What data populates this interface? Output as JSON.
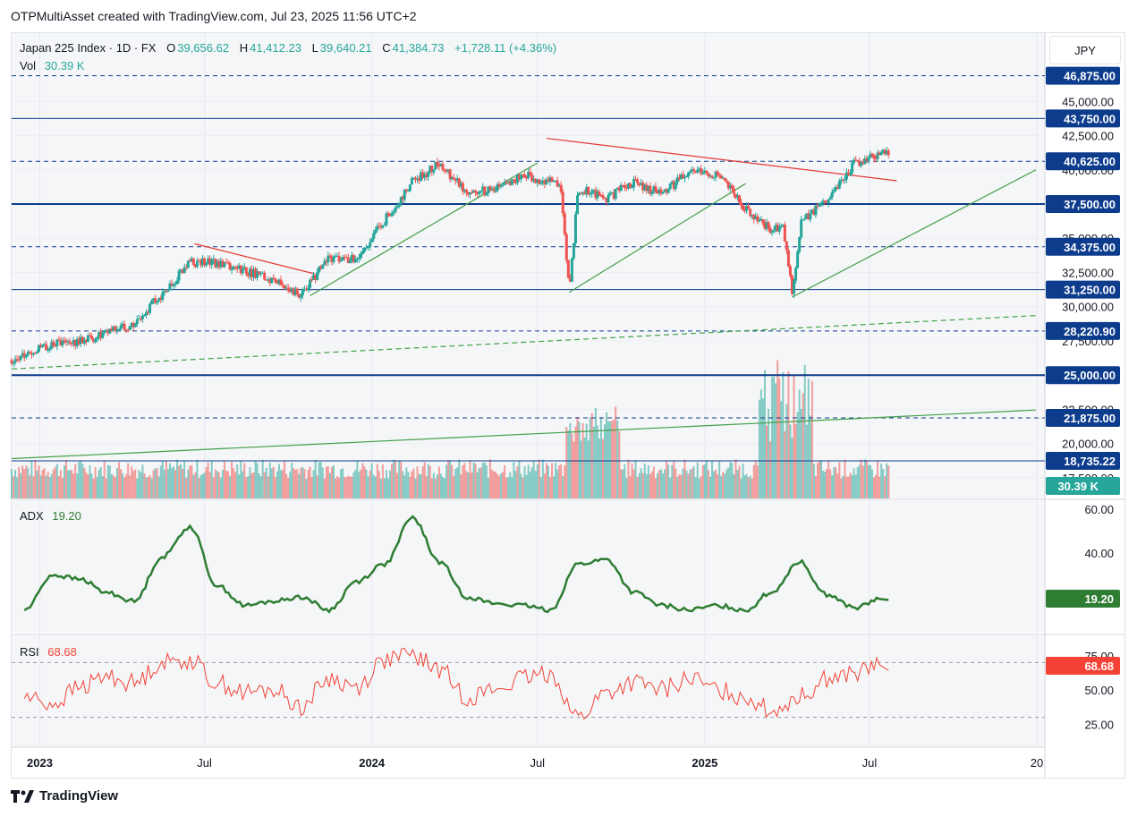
{
  "header": {
    "text": "OTPMultiAsset created with TradingView.com, Jul 23, 2025 11:56 UTC+2"
  },
  "footer": {
    "brand": "TradingView",
    "logo_icon": "tradingview-logo-icon"
  },
  "price_pane": {
    "currency": "JPY",
    "symbol_line": "Japan 225 Index · 1D · FX",
    "ohlc": {
      "o_label": "O",
      "o": "39,656.62",
      "h_label": "H",
      "h": "41,412.23",
      "l_label": "L",
      "l": "39,640.21",
      "c_label": "C",
      "c": "41,384.73",
      "change": "+1,728.11 (+4.36%)"
    },
    "vol_label": "Vol",
    "vol_value": "30.39 K"
  },
  "adx_pane": {
    "label": "ADX",
    "value": "19.20"
  },
  "rsi_pane": {
    "label": "RSI",
    "value": "68.68"
  },
  "colors": {
    "up": "#26a69a",
    "down": "#ef5350",
    "level_line": "#0d3c8c",
    "trend_green": "#43a047",
    "trend_red": "#e53935",
    "adx": "#2e7d32",
    "rsi": "#f44336",
    "vol_badge": "#26a69a",
    "level_badge": "#0d3c8c"
  },
  "chart_data": [
    {
      "type": "candlestick",
      "title": "Japan 225 Index · 1D · FX",
      "x_labels": [
        "2023",
        "Jul",
        "2024",
        "Jul",
        "2025",
        "Jul",
        "20"
      ],
      "y_ticks": [
        "45,000.00",
        "42,500.00",
        "40,000.00",
        "37,500.00",
        "35,000.00",
        "32,500.00",
        "30,000.00",
        "27,500.00",
        "25,000.00",
        "22,500.00",
        "20,000.00",
        "17,500.00"
      ],
      "ylim": [
        15000,
        48000
      ],
      "price_levels": [
        {
          "value": 46875.0,
          "label": "46,875.00",
          "style": "dashed"
        },
        {
          "value": 43750.0,
          "label": "43,750.00",
          "style": "solid"
        },
        {
          "value": 40625.0,
          "label": "40,625.00",
          "style": "dashed"
        },
        {
          "value": 37500.0,
          "label": "37,500.00",
          "style": "thick"
        },
        {
          "value": 34375.0,
          "label": "34,375.00",
          "style": "dashed"
        },
        {
          "value": 31250.0,
          "label": "31,250.00",
          "style": "solid"
        },
        {
          "value": 28220.9,
          "label": "28,220.90",
          "style": "dashed"
        },
        {
          "value": 25000.0,
          "label": "25,000.00",
          "style": "thick"
        },
        {
          "value": 21875.0,
          "label": "21,875.00",
          "style": "dashed"
        },
        {
          "value": 18735.22,
          "label": "18,735.22",
          "style": "solid"
        }
      ],
      "monthly_close": [
        {
          "date": "2022-12",
          "close": 26100
        },
        {
          "date": "2023-01",
          "close": 27300
        },
        {
          "date": "2023-02",
          "close": 27500
        },
        {
          "date": "2023-03",
          "close": 28000
        },
        {
          "date": "2023-04",
          "close": 28800
        },
        {
          "date": "2023-05",
          "close": 30900
        },
        {
          "date": "2023-06",
          "close": 33200
        },
        {
          "date": "2023-07",
          "close": 33200
        },
        {
          "date": "2023-08",
          "close": 32600
        },
        {
          "date": "2023-09",
          "close": 32000
        },
        {
          "date": "2023-10",
          "close": 30900
        },
        {
          "date": "2023-11",
          "close": 33500
        },
        {
          "date": "2023-12",
          "close": 33500
        },
        {
          "date": "2024-01",
          "close": 36300
        },
        {
          "date": "2024-02",
          "close": 39200
        },
        {
          "date": "2024-03",
          "close": 40400
        },
        {
          "date": "2024-04",
          "close": 38400
        },
        {
          "date": "2024-05",
          "close": 38500
        },
        {
          "date": "2024-06",
          "close": 39600
        },
        {
          "date": "2024-07",
          "close": 39100
        },
        {
          "date": "2024-08",
          "close": 38600
        },
        {
          "date": "2024-09",
          "close": 37900
        },
        {
          "date": "2024-10",
          "close": 39100
        },
        {
          "date": "2024-11",
          "close": 38200
        },
        {
          "date": "2024-12",
          "close": 39900
        },
        {
          "date": "2025-01",
          "close": 39600
        },
        {
          "date": "2025-02",
          "close": 37200
        },
        {
          "date": "2025-03",
          "close": 35600
        },
        {
          "date": "2025-04",
          "close": 36000
        },
        {
          "date": "2025-05",
          "close": 37900
        },
        {
          "date": "2025-06",
          "close": 40500
        },
        {
          "date": "2025-07",
          "close": 41384.73
        }
      ]
    },
    {
      "type": "bar",
      "title": "Vol",
      "last_value": "30.39 K"
    },
    {
      "type": "line",
      "title": "ADX",
      "y_ticks": [
        "60.00",
        "40.00"
      ],
      "ylim": [
        0,
        65
      ],
      "last_value": 19.2,
      "monthly": [
        {
          "date": "2022-12",
          "value": 14
        },
        {
          "date": "2023-01",
          "value": 30
        },
        {
          "date": "2023-02",
          "value": 28
        },
        {
          "date": "2023-03",
          "value": 22
        },
        {
          "date": "2023-04",
          "value": 18
        },
        {
          "date": "2023-05",
          "value": 38
        },
        {
          "date": "2023-06",
          "value": 52
        },
        {
          "date": "2023-07",
          "value": 25
        },
        {
          "date": "2023-08",
          "value": 16
        },
        {
          "date": "2023-09",
          "value": 18
        },
        {
          "date": "2023-10",
          "value": 20
        },
        {
          "date": "2023-11",
          "value": 14
        },
        {
          "date": "2023-12",
          "value": 27
        },
        {
          "date": "2024-01",
          "value": 35
        },
        {
          "date": "2024-02",
          "value": 56
        },
        {
          "date": "2024-03",
          "value": 36
        },
        {
          "date": "2024-04",
          "value": 20
        },
        {
          "date": "2024-05",
          "value": 17
        },
        {
          "date": "2024-06",
          "value": 16
        },
        {
          "date": "2024-07",
          "value": 14
        },
        {
          "date": "2024-08",
          "value": 35
        },
        {
          "date": "2024-09",
          "value": 37
        },
        {
          "date": "2024-10",
          "value": 22
        },
        {
          "date": "2024-11",
          "value": 16
        },
        {
          "date": "2024-12",
          "value": 14
        },
        {
          "date": "2025-01",
          "value": 16
        },
        {
          "date": "2025-02",
          "value": 14
        },
        {
          "date": "2025-03",
          "value": 22
        },
        {
          "date": "2025-04",
          "value": 36
        },
        {
          "date": "2025-05",
          "value": 21
        },
        {
          "date": "2025-06",
          "value": 15
        },
        {
          "date": "2025-07",
          "value": 19.2
        }
      ]
    },
    {
      "type": "line",
      "title": "RSI",
      "y_ticks": [
        "75.00",
        "50.00",
        "25.00"
      ],
      "ylim": [
        0,
        90
      ],
      "last_value": 68.68,
      "monthly": [
        {
          "date": "2022-12",
          "value": 45
        },
        {
          "date": "2023-01",
          "value": 40
        },
        {
          "date": "2023-02",
          "value": 52
        },
        {
          "date": "2023-03",
          "value": 60
        },
        {
          "date": "2023-04",
          "value": 55
        },
        {
          "date": "2023-05",
          "value": 70
        },
        {
          "date": "2023-06",
          "value": 72
        },
        {
          "date": "2023-07",
          "value": 55
        },
        {
          "date": "2023-08",
          "value": 48
        },
        {
          "date": "2023-09",
          "value": 50
        },
        {
          "date": "2023-10",
          "value": 38
        },
        {
          "date": "2023-11",
          "value": 58
        },
        {
          "date": "2023-12",
          "value": 52
        },
        {
          "date": "2024-01",
          "value": 72
        },
        {
          "date": "2024-02",
          "value": 75
        },
        {
          "date": "2024-03",
          "value": 65
        },
        {
          "date": "2024-04",
          "value": 45
        },
        {
          "date": "2024-05",
          "value": 50
        },
        {
          "date": "2024-06",
          "value": 58
        },
        {
          "date": "2024-07",
          "value": 62
        },
        {
          "date": "2024-08",
          "value": 30
        },
        {
          "date": "2024-09",
          "value": 48
        },
        {
          "date": "2024-10",
          "value": 55
        },
        {
          "date": "2024-11",
          "value": 50
        },
        {
          "date": "2024-12",
          "value": 58
        },
        {
          "date": "2025-01",
          "value": 50
        },
        {
          "date": "2025-02",
          "value": 45
        },
        {
          "date": "2025-03",
          "value": 35
        },
        {
          "date": "2025-04",
          "value": 45
        },
        {
          "date": "2025-05",
          "value": 58
        },
        {
          "date": "2025-06",
          "value": 62
        },
        {
          "date": "2025-07",
          "value": 68.68
        }
      ]
    }
  ]
}
